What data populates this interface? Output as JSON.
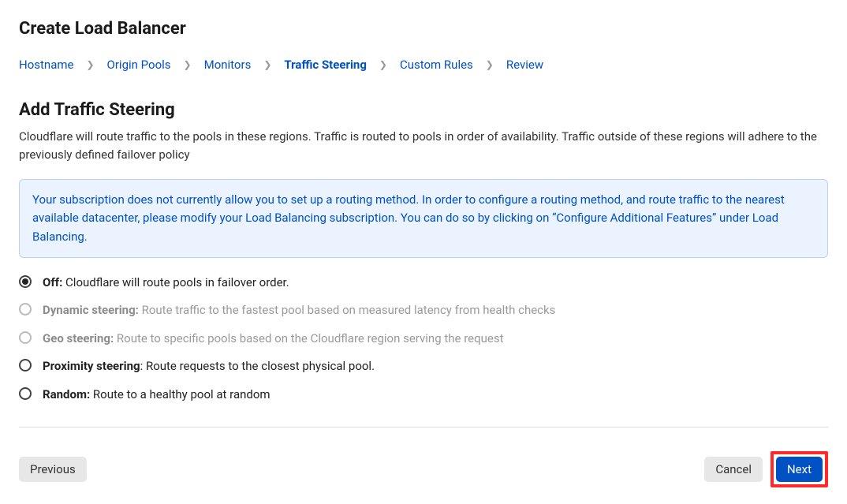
{
  "page_title": "Create Load Balancer",
  "breadcrumb": {
    "items": [
      {
        "label": "Hostname",
        "current": false
      },
      {
        "label": "Origin Pools",
        "current": false
      },
      {
        "label": "Monitors",
        "current": false
      },
      {
        "label": "Traffic Steering",
        "current": true
      },
      {
        "label": "Custom Rules",
        "current": false
      },
      {
        "label": "Review",
        "current": false
      }
    ]
  },
  "section": {
    "title": "Add Traffic Steering",
    "description": "Cloudflare will route traffic to the pools in these regions. Traffic is routed to pools in order of availability. Traffic outside of these regions will adhere to the previously defined failover policy"
  },
  "banner": {
    "text": "Your subscription does not currently allow you to set up a routing method. In order to configure a routing method, and route traffic to the nearest available datacenter, please modify your Load Balancing subscription. You can do so by clicking on “Configure Additional Features” under Load Balancing."
  },
  "options": [
    {
      "name": "Off:",
      "desc": " Cloudflare will route pools in failover order.",
      "checked": true,
      "disabled": false
    },
    {
      "name": "Dynamic steering:",
      "desc": " Route traffic to the fastest pool based on measured latency from health checks",
      "checked": false,
      "disabled": true
    },
    {
      "name": "Geo steering:",
      "desc": " Route to specific pools based on the Cloudflare region serving the request",
      "checked": false,
      "disabled": true
    },
    {
      "name": "Proximity steering",
      "desc": ": Route requests to the closest physical pool.",
      "checked": false,
      "disabled": false
    },
    {
      "name": "Random:",
      "desc": " Route to a healthy pool at random",
      "checked": false,
      "disabled": false
    }
  ],
  "footer": {
    "previous": "Previous",
    "cancel": "Cancel",
    "next": "Next"
  }
}
